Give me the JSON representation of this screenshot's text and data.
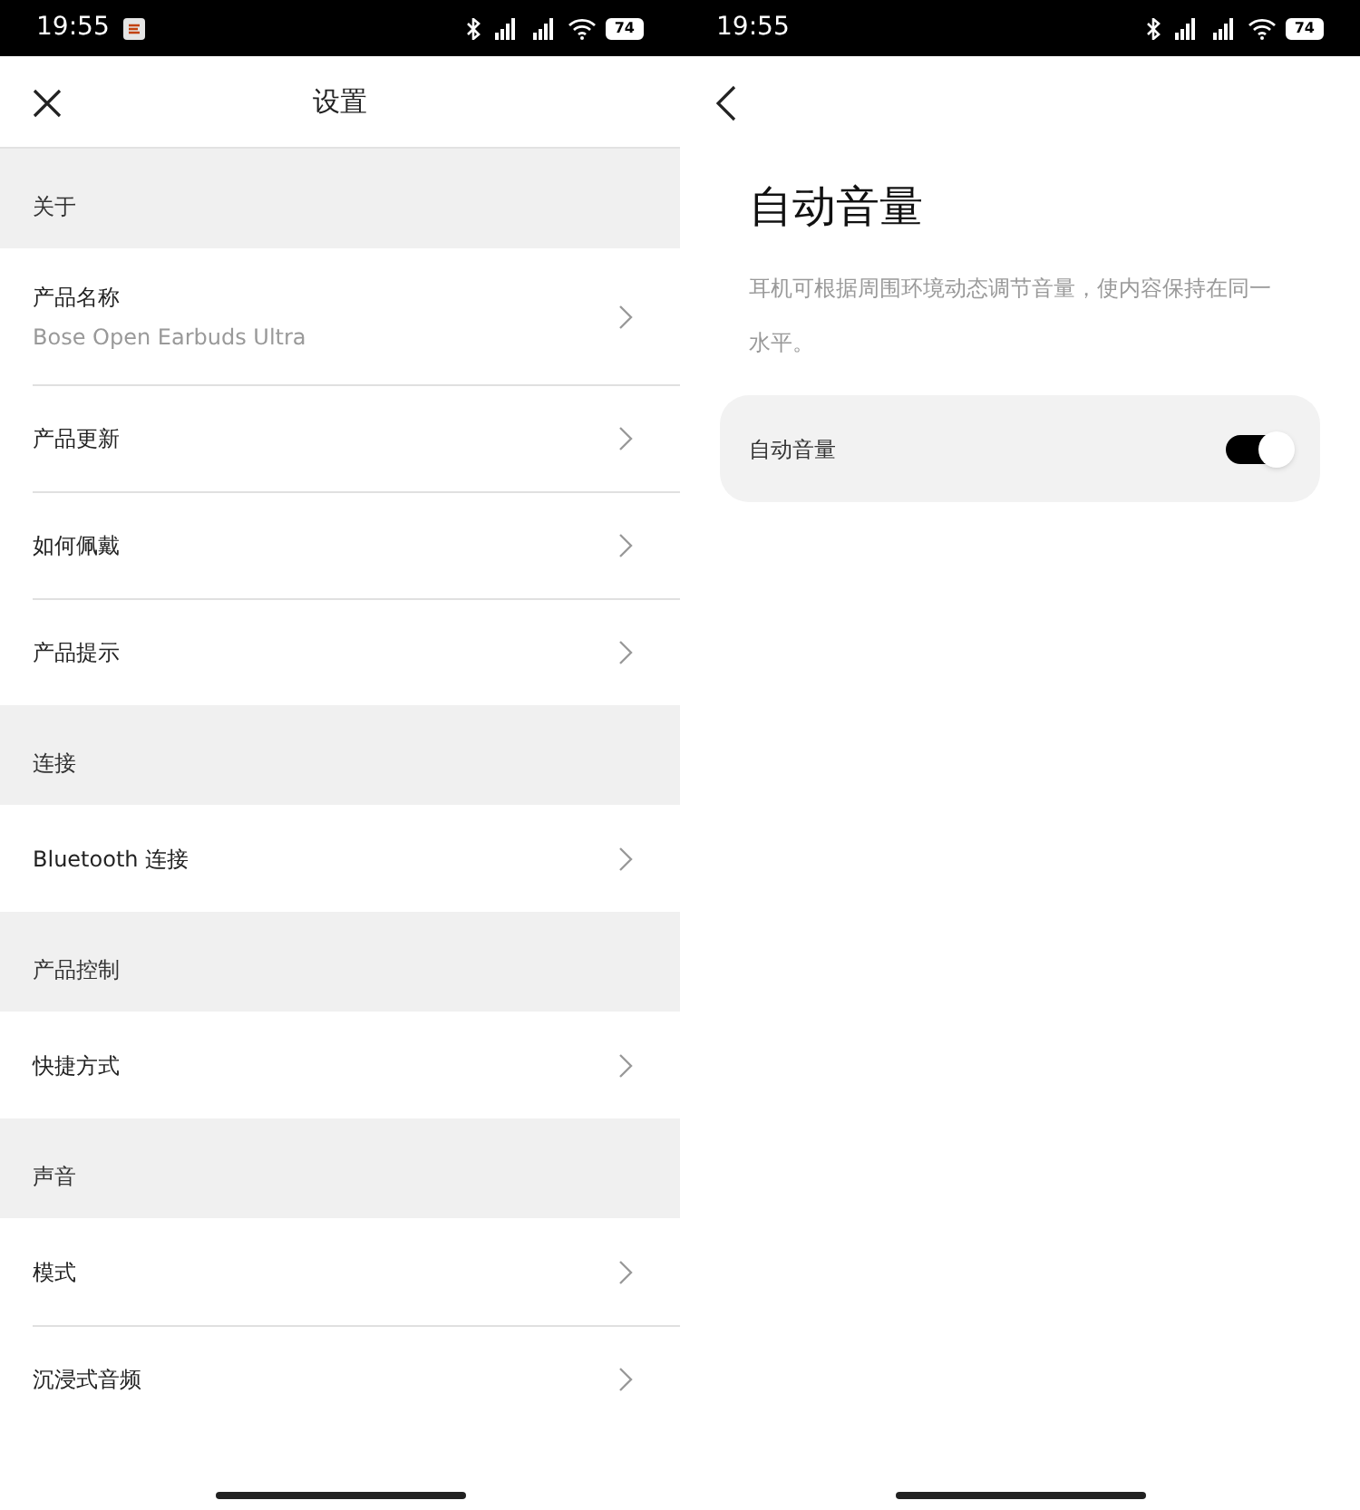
{
  "screens": [
    {
      "status_bar": {
        "time": "19:55",
        "notification_icon": true,
        "battery": "74"
      },
      "header": {
        "title": "设置",
        "leading_icon": {
          "kind": "close"
        }
      },
      "sections": [
        {
          "title": "关于",
          "items": [
            {
              "label": "产品名称",
              "subtitle": "Bose Open Earbuds Ultra"
            },
            {
              "label": "产品更新"
            },
            {
              "label": "如何佩戴"
            },
            {
              "label": "产品提示"
            }
          ]
        },
        {
          "title": "连接",
          "items": [
            {
              "label": "Bluetooth 连接"
            }
          ]
        },
        {
          "title": "产品控制",
          "items": [
            {
              "label": "快捷方式"
            }
          ]
        },
        {
          "title": "声音",
          "items": [
            {
              "label": "模式"
            },
            {
              "label": "沉浸式音频"
            }
          ]
        }
      ]
    },
    {
      "status_bar": {
        "time": "19:55",
        "notification_icon": false,
        "battery": "74"
      },
      "header": {
        "leading_icon": {
          "kind": "back"
        }
      },
      "page": {
        "title": "自动音量",
        "description": "耳机可根据周围环境动态调节音量，使内容保持在同一水平。",
        "setting": {
          "label": "自动音量",
          "on": true
        }
      }
    }
  ]
}
